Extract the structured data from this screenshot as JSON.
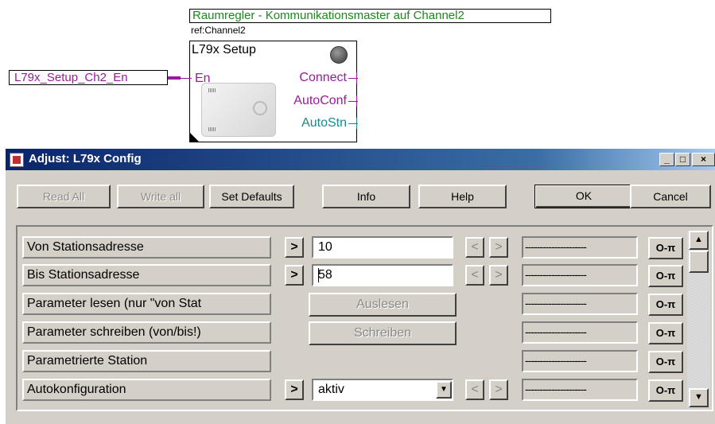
{
  "diagram": {
    "title": "Raumregler - Kommunikationsmaster auf Channel2",
    "ref": "ref:Channel2",
    "block_name": "L79x Setup",
    "input_signal": "L79x_Setup_Ch2_En",
    "ports": {
      "input": "En",
      "outputs": [
        "Connect",
        "AutoConf",
        "AutoStn"
      ]
    },
    "colors": {
      "title": "#1a8a1a",
      "signal": "#9a1a9a",
      "autostn": "#1a8a8a"
    }
  },
  "dialog": {
    "title": "Adjust: L79x Config",
    "window_buttons": [
      "_",
      "□",
      "×"
    ],
    "toolbar": {
      "read_all": "Read All",
      "write_all": "Write all",
      "set_defaults": "Set Defaults",
      "info": "Info",
      "help": "Help",
      "ok": "OK",
      "cancel": "Cancel"
    },
    "rows": [
      {
        "label": "Von Stationsadresse",
        "value": "10"
      },
      {
        "label": "Bis Stationsadresse",
        "value": "58"
      },
      {
        "label": "Parameter lesen (nur \"von Stat",
        "action": "Auslesen"
      },
      {
        "label": "Parameter schreiben (von/bis!)",
        "action": "Schreiben"
      },
      {
        "label": "Parametrierte Station"
      },
      {
        "label": "Autokonfiguration",
        "value": "aktiv"
      }
    ],
    "dashes": "---------------------",
    "key_label": "O-π",
    "arrow_right": ">",
    "arrow_left": "<",
    "dropdown_arrow": "▼",
    "scroll_up": "▲",
    "scroll_down": "▼"
  }
}
